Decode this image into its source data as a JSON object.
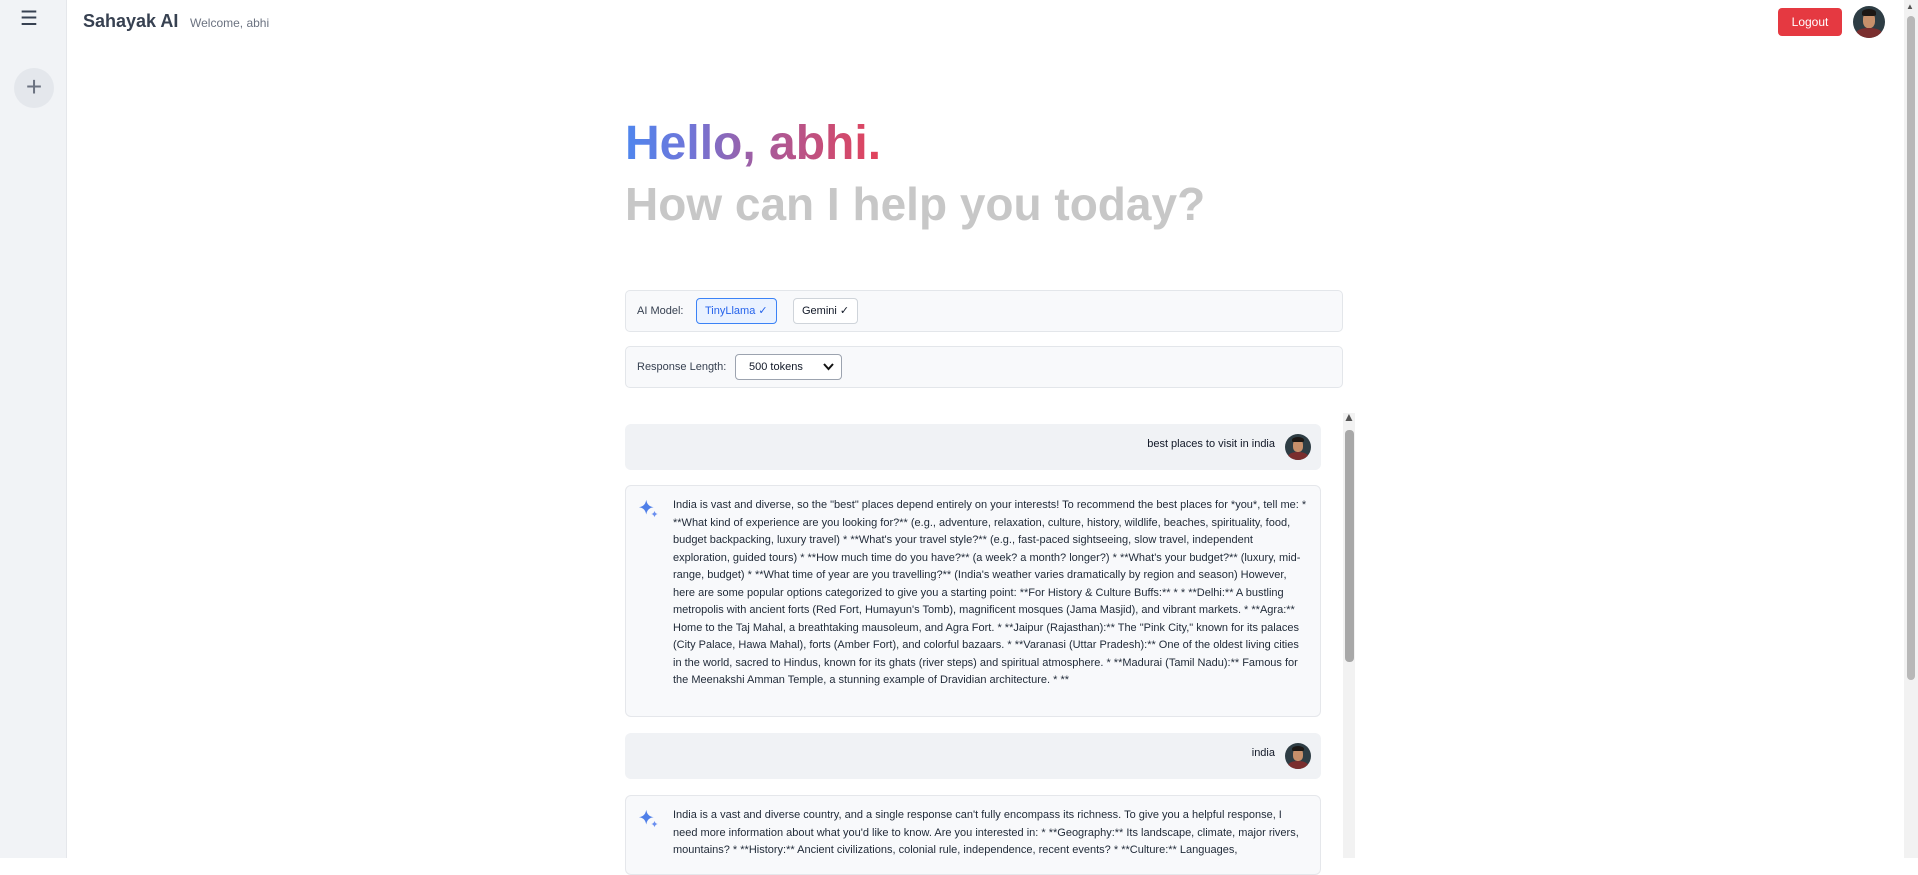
{
  "app": {
    "title": "Sahayak AI",
    "welcome": "Welcome, abhi",
    "logout_label": "Logout"
  },
  "sidebar": {
    "menu_icon": "☰",
    "new_chat_icon": "+"
  },
  "hero": {
    "greeting": "Hello, abhi.",
    "subtitle": "How can I help you today?"
  },
  "settings": {
    "model_label": "AI Model:",
    "models": [
      {
        "label": "TinyLlama ✓",
        "selected": true
      },
      {
        "label": "Gemini ✓",
        "selected": false
      }
    ],
    "length_label": "Response Length:",
    "length_value": "500 tokens"
  },
  "chat": {
    "messages": [
      {
        "role": "user",
        "text": "best places to visit in india"
      },
      {
        "role": "assistant",
        "text": "India is vast and diverse, so the \"best\" places depend entirely on your interests! To recommend the best places for *you*, tell me: * **What kind of experience are you looking for?** (e.g., adventure, relaxation, culture, history, wildlife, beaches, spirituality, food, budget backpacking, luxury travel) * **What's your travel style?** (e.g., fast-paced sightseeing, slow travel, independent exploration, guided tours) * **How much time do you have?** (a week? a month? longer?) * **What's your budget?** (luxury, mid-range, budget) * **What time of year are you travelling?** (India's weather varies dramatically by region and season) However, here are some popular options categorized to give you a starting point: **For History & Culture Buffs:** * * **Delhi:** A bustling metropolis with ancient forts (Red Fort, Humayun's Tomb), magnificent mosques (Jama Masjid), and vibrant markets. * **Agra:** Home to the Taj Mahal, a breathtaking mausoleum, and Agra Fort. * **Jaipur (Rajasthan):** The \"Pink City,\" known for its palaces (City Palace, Hawa Mahal), forts (Amber Fort), and colorful bazaars. * **Varanasi (Uttar Pradesh):** One of the oldest living cities in the world, sacred to Hindus, known for its ghats (river steps) and spiritual atmosphere. * **Madurai (Tamil Nadu):** Famous for the Meenakshi Amman Temple, a stunning example of Dravidian architecture. * **"
      },
      {
        "role": "user",
        "text": "india"
      },
      {
        "role": "assistant",
        "text": "India is a vast and diverse country, and a single response can't fully encompass its richness. To give you a helpful response, I need more information about what you'd like to know. Are you interested in: * **Geography:** Its landscape, climate, major rivers, mountains? * **History:** Ancient civilizations, colonial rule, independence, recent events? * **Culture:** Languages,"
      }
    ]
  },
  "colors": {
    "accent": "#3b82f6",
    "logout": "#e53941",
    "sidebar": "#f1f3f6"
  },
  "icons": {
    "menu": "hamburger-menu-icon",
    "new_chat": "plus-icon",
    "assistant": "sparkle-icon",
    "select": "chevron-down-icon"
  }
}
